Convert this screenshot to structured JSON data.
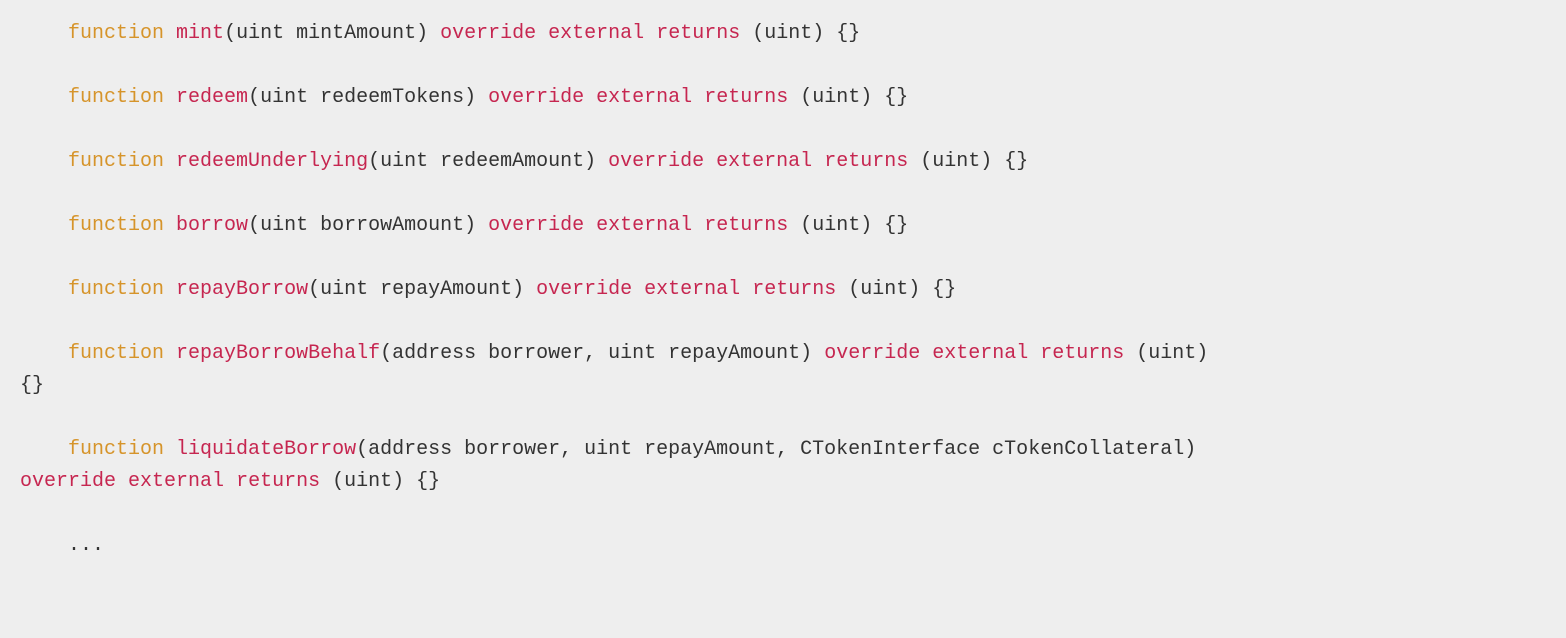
{
  "indent": "    ",
  "kw_function": "function",
  "kw_override": "override",
  "kw_external": "external",
  "kw_returns": "returns",
  "ellipsis": "...",
  "lines": {
    "l1": {
      "name": "mint",
      "params": "(uint mintAmount)",
      "ret": "(uint)",
      "body": "{}"
    },
    "l2": {
      "name": "redeem",
      "params": "(uint redeemTokens)",
      "ret": "(uint)",
      "body": "{}"
    },
    "l3": {
      "name": "redeemUnderlying",
      "params": "(uint redeemAmount)",
      "ret": "(uint)",
      "body": "{}"
    },
    "l4": {
      "name": "borrow",
      "params": "(uint borrowAmount)",
      "ret": "(uint)",
      "body": "{}"
    },
    "l5": {
      "name": "repayBorrow",
      "params": "(uint repayAmount)",
      "ret": "(uint)",
      "body": "{}"
    },
    "l6": {
      "name": "repayBorrowBehalf",
      "params": "(address borrower, uint repayAmount)",
      "ret": "(uint)",
      "body_wrapped": "{}"
    },
    "l7": {
      "name": "liquidateBorrow",
      "params": "(address borrower, uint repayAmount, CTokenInterface cTokenCollateral)",
      "ret": "(uint)",
      "body": "{}"
    }
  }
}
